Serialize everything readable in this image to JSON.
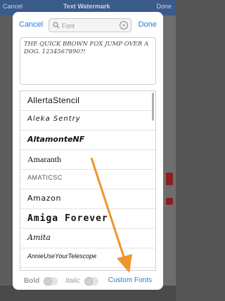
{
  "background": {
    "title": "Text Watermark",
    "left_button": "Cancel",
    "right_button": "Done"
  },
  "nav": {
    "cancel": "Cancel",
    "done": "Done"
  },
  "search": {
    "placeholder": "Font",
    "icon": "search-icon"
  },
  "preview": {
    "text": "THE QUICK BROWN FOX JUMP OVER A DOG. 1234567890?!"
  },
  "fonts": [
    "AllertaStencil",
    "Aleka Sentry",
    "AltamonteNF",
    "Amaranth",
    "AMATICSC",
    "Amazon",
    "Amiga Forever",
    "Amita",
    "AnnieUseYourTelescope"
  ],
  "bottom": {
    "bold_label": "Bold",
    "italic_label": "Italic",
    "custom_fonts": "Custom Fonts"
  },
  "colors": {
    "accent": "#2a7ad4",
    "annotation_arrow": "#f0942c"
  }
}
